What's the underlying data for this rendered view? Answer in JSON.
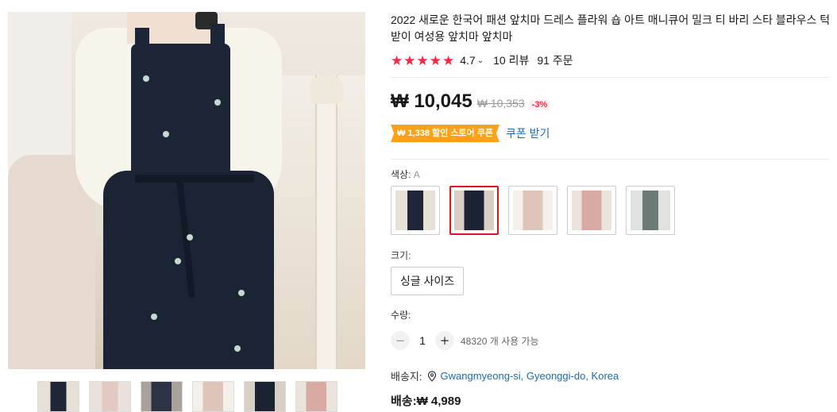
{
  "product": {
    "title": "2022 새로운 한국어 패션 앞치마 드레스 플라워 숍 아트 매니큐어 밀크 티 바리 스타 블라우스 턱받이 여성용 앞치마 앞치마",
    "rating": "4.7",
    "reviews": "10 리뷰",
    "orders": "91 주문",
    "price": "₩ 10,045",
    "original_price": "₩ 10,353",
    "discount": "-3%"
  },
  "coupon": {
    "tag": "₩ 1,338 할인 스토어 쿠폰",
    "link": "쿠폰 받기"
  },
  "color": {
    "label": "색상:",
    "selected": "A",
    "options": [
      "navy-white",
      "navy-floral",
      "pink-blouse",
      "pink-dress",
      "grey-dress"
    ],
    "selected_index": 1
  },
  "size": {
    "label": "크기:",
    "option": "싱글 사이즈"
  },
  "quantity": {
    "label": "수량:",
    "value": "1",
    "minus": "−",
    "plus": "+",
    "available": "48320 개 사용 가능"
  },
  "shipping": {
    "label": "배송지:",
    "location": "Gwangmyeong-si, Gyeonggi-do, Korea",
    "fee": "배송:₩ 4,989"
  },
  "colors": {
    "star": "#fe2442",
    "coupon_bg": "#fda218",
    "link": "#1b6bb5",
    "selected_border": "#e4141b"
  }
}
